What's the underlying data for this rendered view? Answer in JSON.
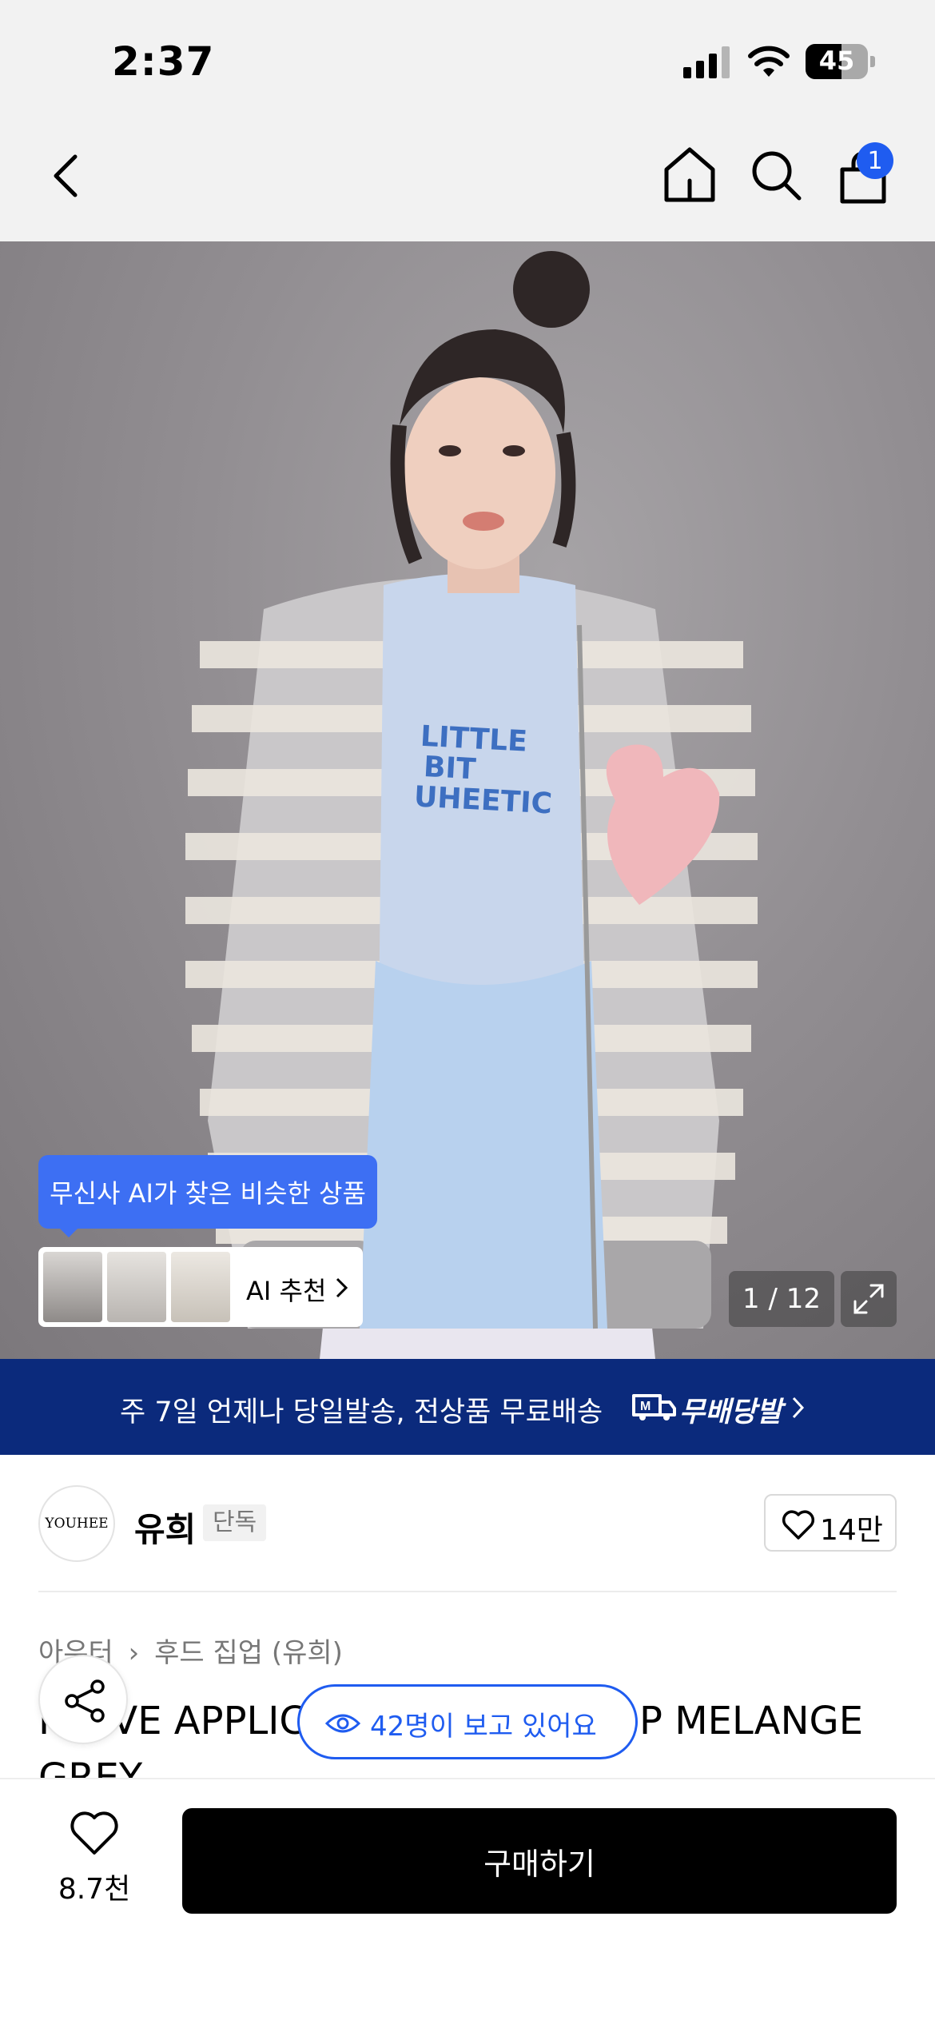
{
  "status_bar": {
    "time": "2:37",
    "battery": "45"
  },
  "header": {
    "cart_count": "1"
  },
  "hero": {
    "ai_tooltip": "무신사 AI가 찾은 비슷한 상품",
    "ai_recommend_label": "AI 추천",
    "image_counter": "1 / 12",
    "shirt_text": [
      "LITTLE",
      "BIT",
      "UHEETIC"
    ]
  },
  "delivery_banner": {
    "text": "주 7일 언제나 당일발송, 전상품 무료배송",
    "badge": "무배당발"
  },
  "brand": {
    "logo_text": "YOUHEE",
    "name": "유희",
    "tag": "단독",
    "likes": "14만"
  },
  "breadcrumb": {
    "category": "아우터",
    "subcategory": "후드 집업 (유희)"
  },
  "product": {
    "title_left": "I LOVE APPLIC",
    "title_right": "P MELANGE",
    "title_line2": "GREY"
  },
  "viewers_badge": "42명이 보고 있어요",
  "bottom_bar": {
    "wish_count": "8.7천",
    "buy_label": "구매하기"
  },
  "colors": {
    "accent": "#1f5cf0",
    "banner": "#0b2a7c",
    "black": "#000000"
  }
}
